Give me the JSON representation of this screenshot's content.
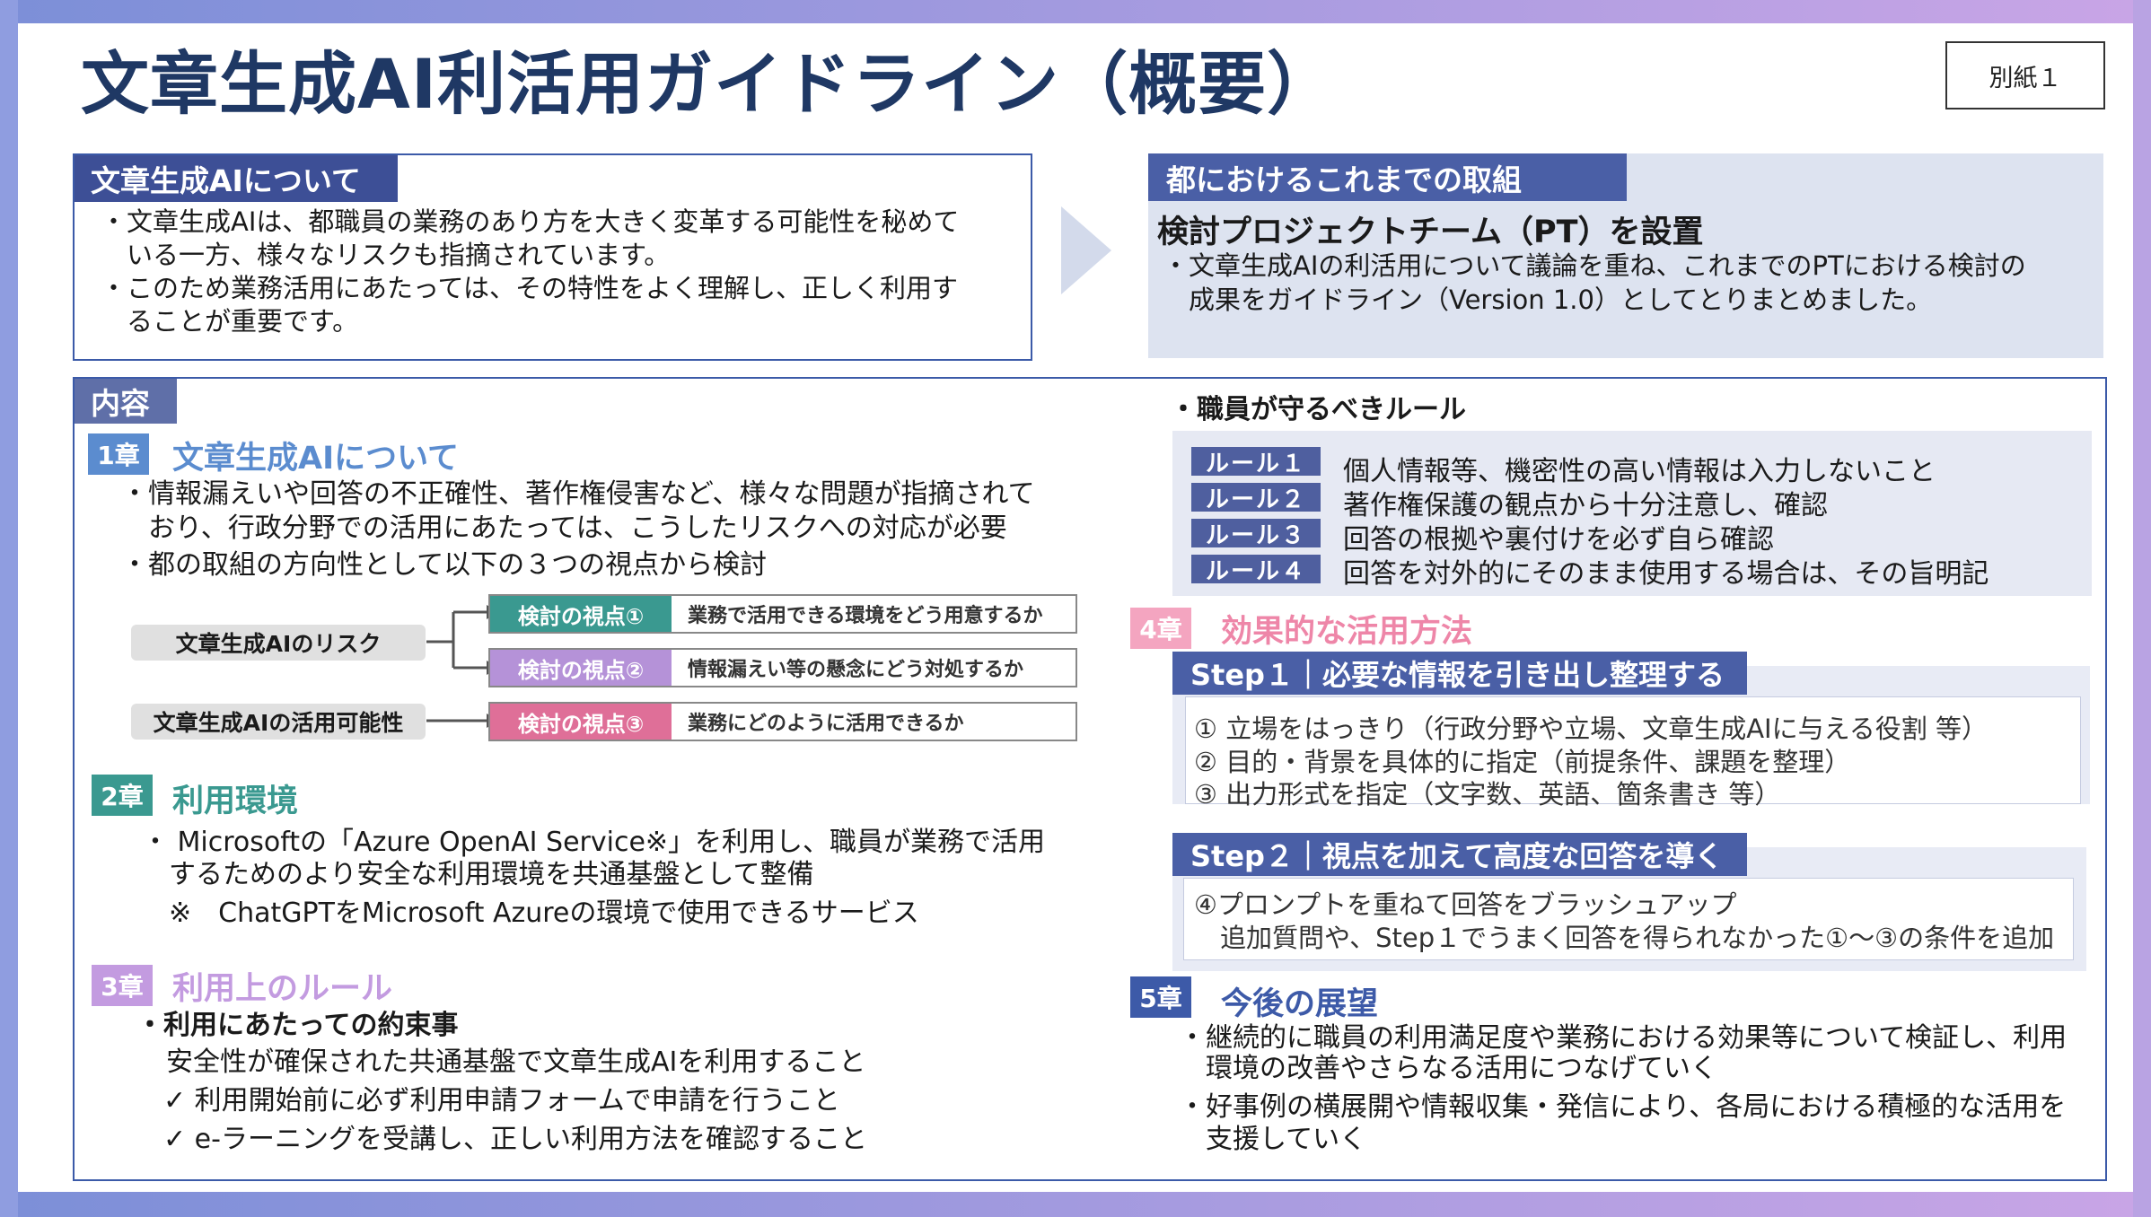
{
  "title": "文章生成AI利活用ガイドライン（概要）",
  "attachment_label": "別紙１",
  "about": {
    "heading": "文章生成AIについて",
    "lines": [
      "・文章生成AIは、都職員の業務のあり方を大きく変革する可能性を秘めて",
      "　いる一方、様々なリスクも指摘されています。",
      "・このため業務活用にあたっては、その特性をよく理解し、正しく利用す",
      "　ることが重要です。"
    ]
  },
  "efforts": {
    "heading": "都におけるこれまでの取組",
    "subheading": "検討プロジェクトチーム（PT）を設置",
    "lines": [
      "・文章生成AIの利活用について議論を重ね、これまでのPTにおける検討の",
      "　成果をガイドライン（Version 1.0）としてとりまとめました。"
    ]
  },
  "content": {
    "heading": "内容",
    "ch1": {
      "badge": "1章",
      "title": "文章生成AIについて",
      "lines": [
        "・情報漏えいや回答の不正確性、著作権侵害など、様々な問題が指摘されて",
        "　おり、行政分野での活用にあたっては、こうしたリスクへの対応が必要",
        "・都の取組の方向性として以下の３つの視点から検討"
      ],
      "flow": {
        "risk": "文章生成AIのリスク",
        "potential": "文章生成AIの活用可能性",
        "views": [
          {
            "label": "検討の視点①",
            "text": "業務で活用できる環境をどう用意するか",
            "color": "#3a9990"
          },
          {
            "label": "検討の視点②",
            "text": "情報漏えい等の懸念にどう対処するか",
            "color": "#b592d8"
          },
          {
            "label": "検討の視点③",
            "text": "業務にどのように活用できるか",
            "color": "#df6f98"
          }
        ]
      }
    },
    "ch2": {
      "badge": "2章",
      "title": "利用環境",
      "lines": [
        "・ Microsoftの「Azure OpenAI Service※」を利用し、職員が業務で活用",
        "　するためのより安全な利用環境を共通基盤として整備",
        "　※　ChatGPTをMicrosoft Azureの環境で使用できるサービス"
      ]
    },
    "ch3": {
      "badge": "3章",
      "title": "利用上のルール",
      "sub": "・利用にあたっての約束事",
      "lines": [
        "安全性が確保された共通基盤で文章生成AIを利用すること",
        "✓ 利用開始前に必ず利用申請フォームで申請を行うこと",
        "✓ e-ラーニングを受講し、正しい利用方法を確認すること"
      ],
      "rules_heading": "・職員が守るべきルール",
      "rules": [
        {
          "badge": "ルール１",
          "text": "個人情報等、機密性の高い情報は入力しないこと"
        },
        {
          "badge": "ルール２",
          "text": "著作権保護の観点から十分注意し、確認"
        },
        {
          "badge": "ルール３",
          "text": "回答の根拠や裏付けを必ず自ら確認"
        },
        {
          "badge": "ルール４",
          "text": "回答を対外的にそのまま使用する場合は、その旨明記"
        }
      ]
    },
    "ch4": {
      "badge": "4章",
      "title": "効果的な活用方法",
      "step1": {
        "title": "Step１｜必要な情報を引き出し整理する",
        "lines": [
          "① 立場をはっきり（行政分野や立場、文章生成AIに与える役割 等）",
          "② 目的・背景を具体的に指定（前提条件、課題を整理）",
          "③ 出力形式を指定（文字数、英語、箇条書き 等）"
        ]
      },
      "step2": {
        "title": "Step２｜視点を加えて高度な回答を導く",
        "lines": [
          "④プロンプトを重ねて回答をブラッシュアップ",
          "　追加質問や、Step１でうまく回答を得られなかった①～③の条件を追加"
        ]
      }
    },
    "ch5": {
      "badge": "5章",
      "title": "今後の展望",
      "lines": [
        "・継続的に職員の利用満足度や業務における効果等について検証し、利用",
        "　環境の改善やさらなる活用につなげていく",
        "・好事例の横展開や情報収集・発信により、各局における積極的な活用を",
        "　支援していく"
      ]
    }
  },
  "colors": {
    "navy": "#1f3864",
    "tag": "#3d4f96",
    "ch1": "#5b8ccf",
    "ch2": "#3a9990",
    "ch3": "#c39be0",
    "ch4": "#ee86a8",
    "ch5": "#3d5aa8"
  }
}
